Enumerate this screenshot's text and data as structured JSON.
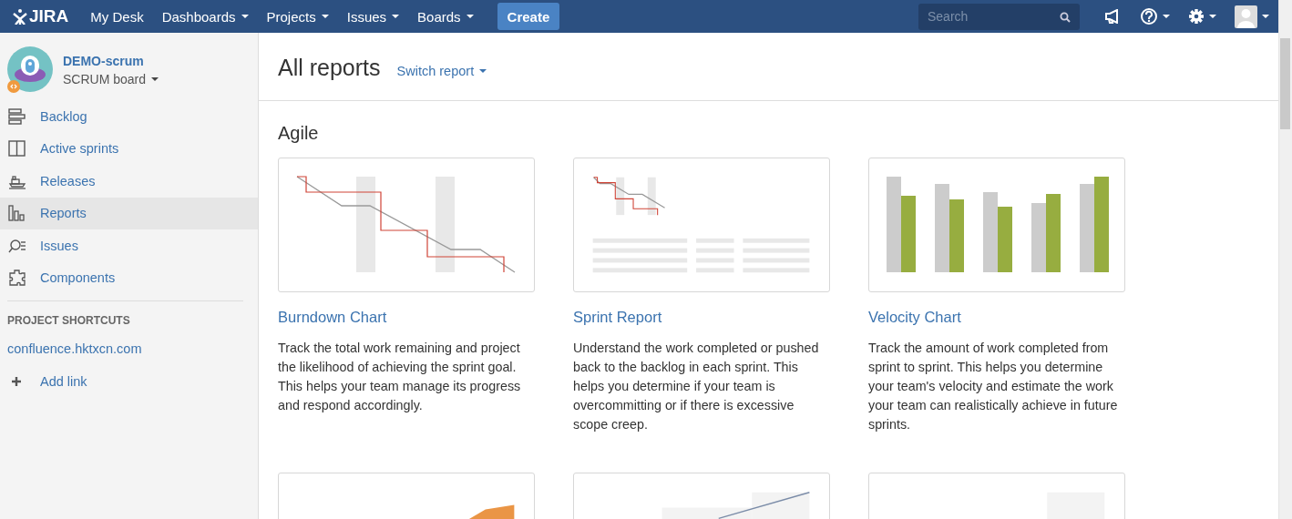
{
  "topbar": {
    "logo": "JIRA",
    "nav": [
      {
        "label": "My Desk",
        "dropdown": false
      },
      {
        "label": "Dashboards",
        "dropdown": true
      },
      {
        "label": "Projects",
        "dropdown": true
      },
      {
        "label": "Issues",
        "dropdown": true
      },
      {
        "label": "Boards",
        "dropdown": true
      }
    ],
    "create": "Create",
    "search": {
      "placeholder": "Search"
    }
  },
  "sidebar": {
    "project": {
      "name": "DEMO-scrum",
      "board": "SCRUM board"
    },
    "items": [
      {
        "label": "Backlog",
        "selected": false
      },
      {
        "label": "Active sprints",
        "selected": false
      },
      {
        "label": "Releases",
        "selected": false
      },
      {
        "label": "Reports",
        "selected": true
      },
      {
        "label": "Issues",
        "selected": false
      },
      {
        "label": "Components",
        "selected": false
      }
    ],
    "shortcuts_heading": "PROJECT SHORTCUTS",
    "shortcuts": [
      "confluence.hktxcn.com"
    ],
    "add_link": "Add link"
  },
  "header": {
    "title": "All reports",
    "switch": "Switch report"
  },
  "section": "Agile",
  "reports": [
    {
      "kind": "burndown",
      "title": "Burndown Chart",
      "description": "Track the total work remaining and project the likelihood of achieving the sprint goal. This helps your team manage its progress and respond accordingly."
    },
    {
      "kind": "sprint",
      "title": "Sprint Report",
      "description": "Understand the work completed or pushed back to the backlog in each sprint. This helps you determine if your team is overcommitting or if there is excessive scope creep."
    },
    {
      "kind": "velocity",
      "title": "Velocity Chart",
      "description": "Track the amount of work completed from sprint to sprint. This helps you determine your team's velocity and estimate the work your team can realistically achieve in future sprints."
    },
    {
      "kind": "area"
    },
    {
      "kind": "line"
    },
    {
      "kind": "blank"
    }
  ]
}
